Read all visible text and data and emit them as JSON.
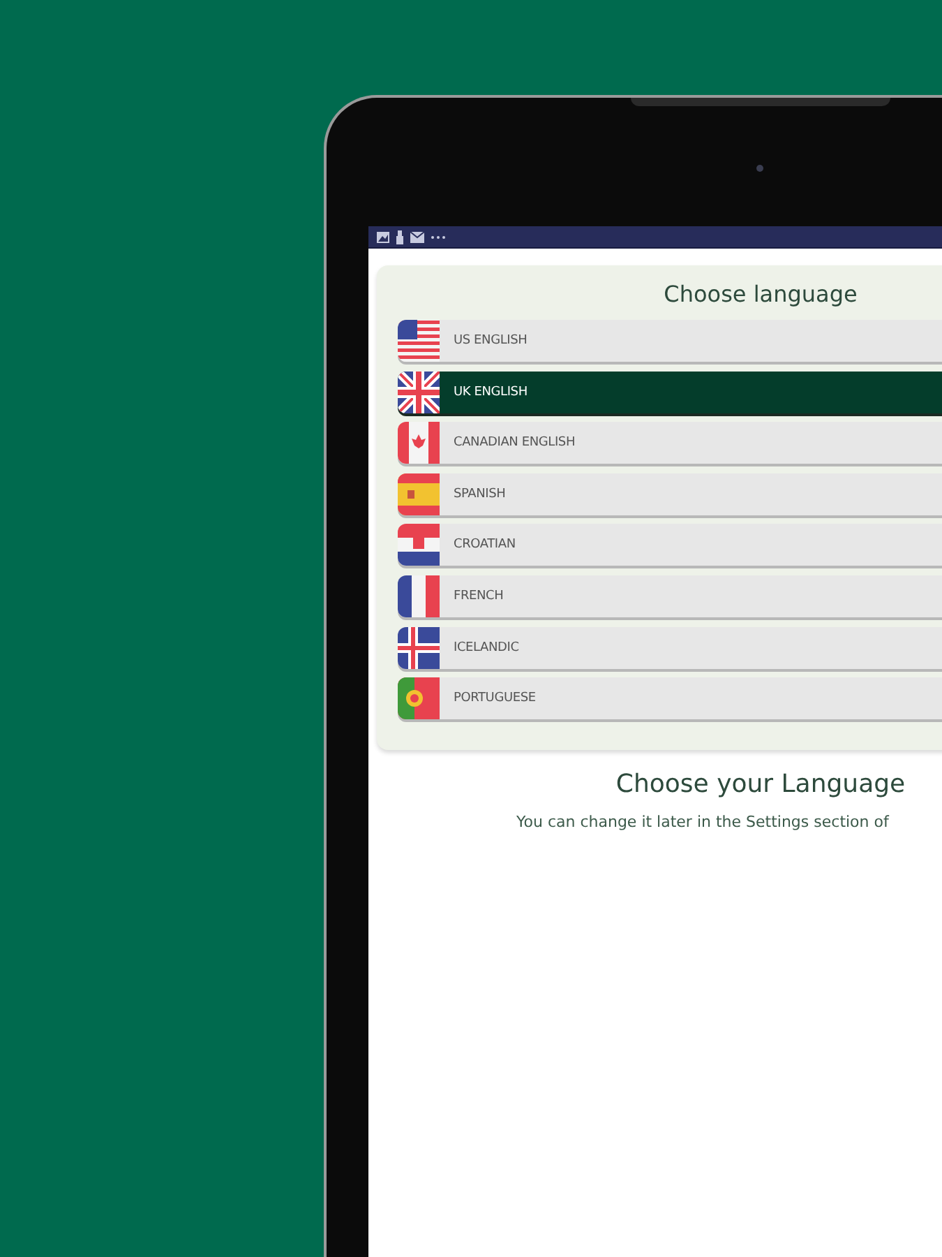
{
  "languages": [
    {
      "label": "US ENGLISH",
      "kind": "us",
      "selected": false
    },
    {
      "label": "UK ENGLISH",
      "kind": "uk",
      "selected": true
    },
    {
      "label": "CANADIAN ENGLISH",
      "kind": "ca",
      "selected": false
    },
    {
      "label": "SPANISH",
      "kind": "es",
      "selected": false
    },
    {
      "label": "CROATIAN",
      "kind": "hr",
      "selected": false
    },
    {
      "label": "FRENCH",
      "kind": "fr",
      "selected": false
    },
    {
      "label": "ICELANDIC",
      "kind": "is",
      "selected": false
    },
    {
      "label": "PORTUGUESE",
      "kind": "pt",
      "selected": false
    }
  ],
  "card_title": "Choose language",
  "heading": "Choose your Language",
  "hint": "You can change it later in the Settings section of"
}
